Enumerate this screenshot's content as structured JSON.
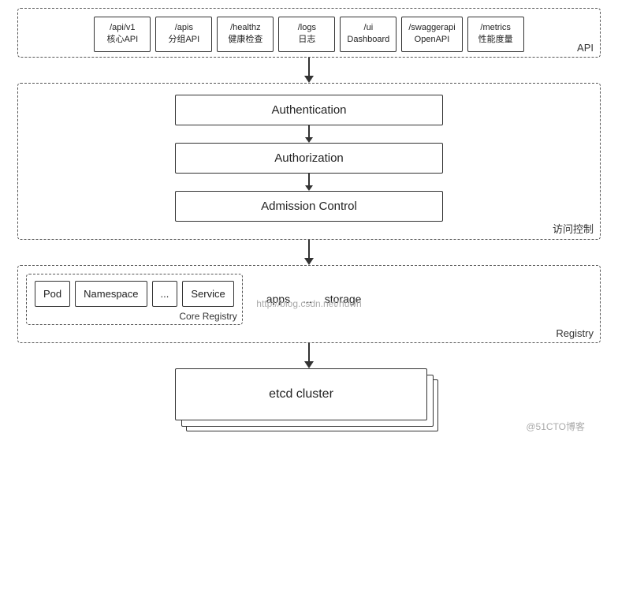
{
  "api": {
    "label": "API",
    "boxes": [
      {
        "line1": "/api/v1",
        "line2": "核心API"
      },
      {
        "line1": "/apis",
        "line2": "分组API"
      },
      {
        "line1": "/healthz",
        "line2": "健康检查"
      },
      {
        "line1": "/logs",
        "line2": "日志"
      },
      {
        "line1": "/ui",
        "line2": "Dashboard"
      },
      {
        "line1": "/swaggerapi",
        "line2": "OpenAPI"
      },
      {
        "line1": "/metrics",
        "line2": "性能度量"
      }
    ]
  },
  "access_control": {
    "label": "访问控制",
    "authentication": "Authentication",
    "authorization": "Authorization",
    "admission_control": "Admission Control"
  },
  "registry": {
    "label": "Registry",
    "core_registry": {
      "label": "Core Registry",
      "items": [
        "Pod",
        "Namespace",
        "...",
        "Service"
      ]
    },
    "right_items": [
      "apps",
      "...",
      "storage"
    ]
  },
  "etcd": {
    "label": "etcd cluster"
  },
  "watermark": "http://blog.csdn.net/huwh",
  "watermark2": "@51CTO博客"
}
